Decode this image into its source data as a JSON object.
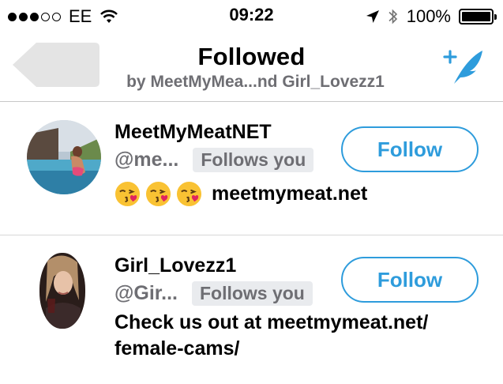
{
  "status_bar": {
    "carrier": "EE",
    "time": "09:22",
    "battery": "100%",
    "battery_level": 1.0,
    "signal_bars_filled": 3,
    "signal_bars_total": 5,
    "icons": [
      "wifi-icon",
      "location-arrow-icon",
      "bluetooth-icon",
      "battery-icon"
    ]
  },
  "nav": {
    "title": "Followed",
    "subtitle": "by MeetMyMea...nd Girl_Lovezz1",
    "back_icon": "back-arrow-icon",
    "compose_icon": "compose-tweet-icon"
  },
  "users": [
    {
      "name": "MeetMyMeatNET",
      "handle": "@me...",
      "follows_you": "Follows you",
      "follow_label": "Follow",
      "bio_emoji": [
        "face-blowing-kiss",
        "face-blowing-kiss",
        "face-blowing-kiss"
      ],
      "bio_text": "meetmymeat.net"
    },
    {
      "name": "Girl_Lovezz1",
      "handle": "@Gir...",
      "follows_you": "Follows you",
      "follow_label": "Follow",
      "bio_text": "Check us out at meetmymeat.net/ female-cams/"
    }
  ],
  "colors": {
    "accent": "#2e9cdc",
    "secondary_text": "#6e6e73",
    "badge_bg": "#e9ebee"
  }
}
